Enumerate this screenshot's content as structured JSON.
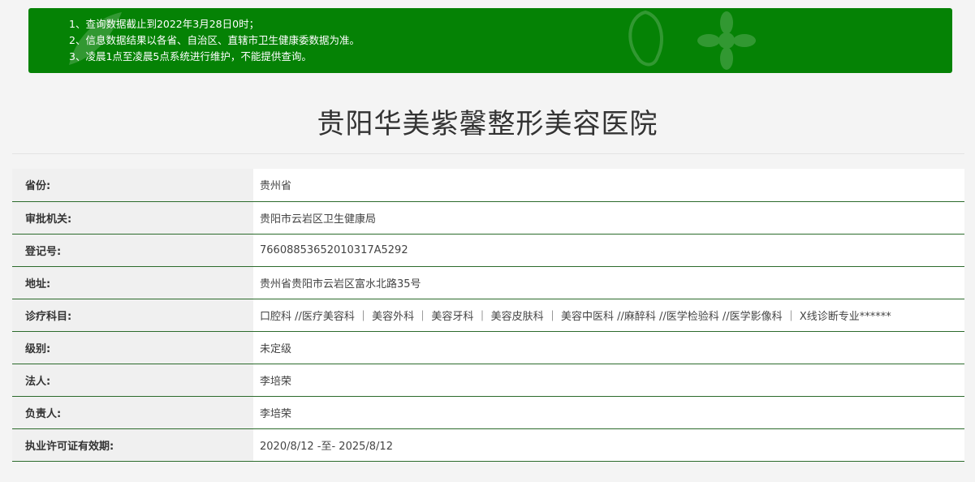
{
  "notice": {
    "lines": [
      "1、查询数据截止到2022年3月28日0时；",
      "2、信息数据结果以各省、自治区、直辖市卫生健康委数据为准。",
      "3、凌晨1点至凌晨5点系统进行维护，不能提供查询。"
    ]
  },
  "hospital_name": "贵阳华美紫馨整形美容医院",
  "rows": [
    {
      "label": "省份:",
      "value": "贵州省"
    },
    {
      "label": "审批机关:",
      "value": "贵阳市云岩区卫生健康局"
    },
    {
      "label": "登记号:",
      "value": "76608853652010317A5292"
    },
    {
      "label": "地址:",
      "value": "贵州省贵阳市云岩区富水北路35号"
    },
    {
      "label": "诊疗科目:",
      "value": "口腔科 //医疗美容科 ｜ 美容外科 ｜ 美容牙科 ｜ 美容皮肤科 ｜ 美容中医科 //麻醉科 //医学检验科 //医学影像科 ｜ X线诊断专业******"
    },
    {
      "label": "级别:",
      "value": "未定级"
    },
    {
      "label": "法人:",
      "value": "李培荣"
    },
    {
      "label": "负责人:",
      "value": "李培荣"
    },
    {
      "label": "执业许可证有效期:",
      "value": "2020/8/12 -至- 2025/8/12"
    }
  ],
  "colors": {
    "notice_bg": "#058205",
    "row_border": "#2c6b2c"
  }
}
